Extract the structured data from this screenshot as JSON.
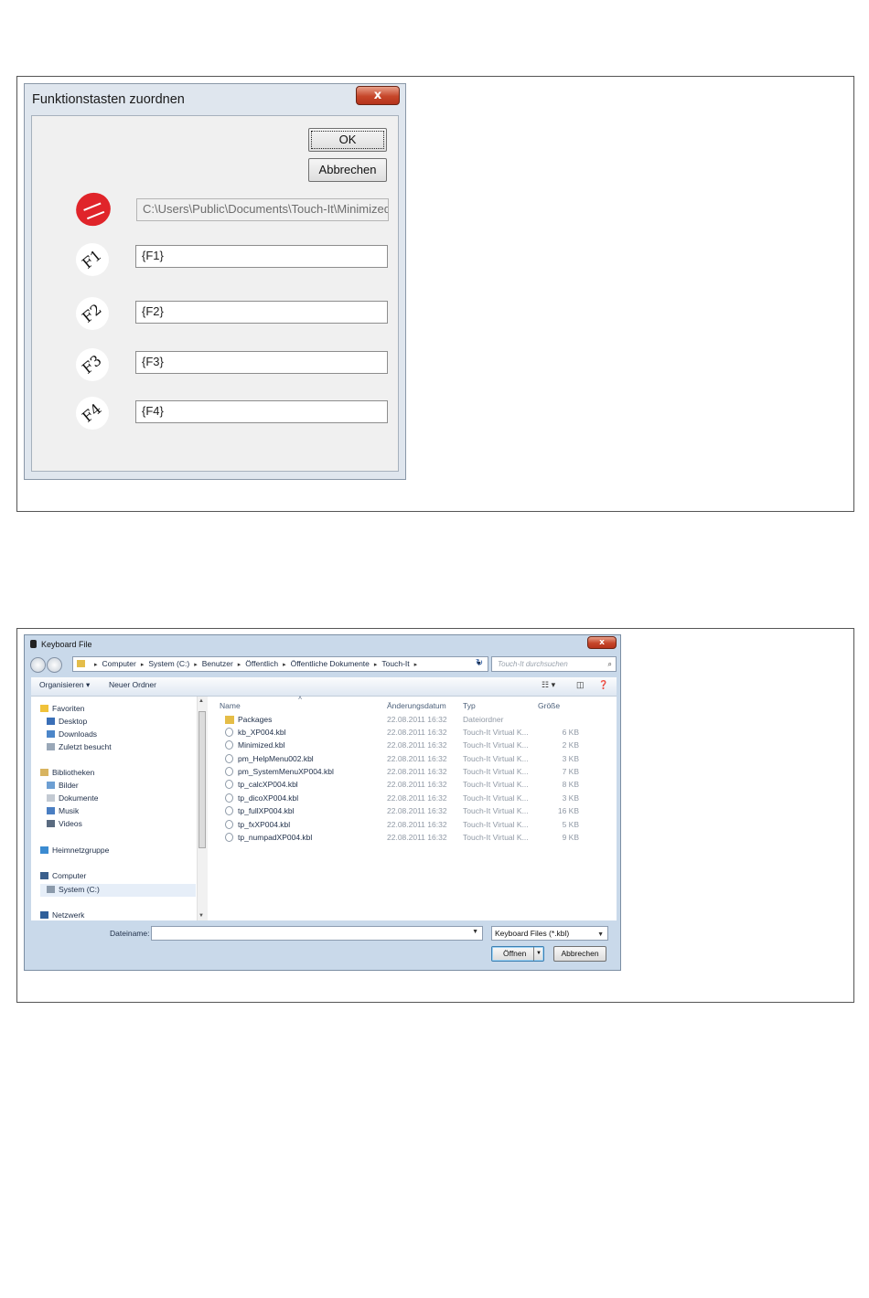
{
  "dialog1": {
    "title": "Funktionstasten zuordnen",
    "close_label": "x",
    "ok_label": "OK",
    "cancel_label": "Abbrechen",
    "path_value": "C:\\Users\\Public\\Documents\\Touch-It\\Minimized.",
    "app_icon": "touch-it-red-icon",
    "keys": [
      {
        "icon_label": "F1",
        "value": "{F1}"
      },
      {
        "icon_label": "F2",
        "value": "{F2}"
      },
      {
        "icon_label": "F3",
        "value": "{F3}"
      },
      {
        "icon_label": "F4",
        "value": "{F4}"
      }
    ]
  },
  "dialog2": {
    "title": "Keyboard File",
    "close_label": "x",
    "breadcrumb": [
      "Computer",
      "System (C:)",
      "Benutzer",
      "Öffentlich",
      "Öffentliche Dokumente",
      "Touch-It"
    ],
    "search_placeholder": "Touch-It durchsuchen",
    "toolbar": {
      "organize": "Organisieren ▾",
      "new_folder": "Neuer Ordner"
    },
    "nav": {
      "favorites": "Favoriten",
      "desktop": "Desktop",
      "downloads": "Downloads",
      "recent": "Zuletzt besucht",
      "libraries": "Bibliotheken",
      "pictures": "Bilder",
      "documents": "Dokumente",
      "music": "Musik",
      "videos": "Videos",
      "homegroup": "Heimnetzgruppe",
      "computer": "Computer",
      "system": "System (C:)",
      "network": "Netzwerk"
    },
    "columns": {
      "name": "Name",
      "date": "Änderungsdatum",
      "type": "Typ",
      "size": "Größe"
    },
    "files": [
      {
        "name": "Packages",
        "date": "22.08.2011 16:32",
        "type": "Dateiordner",
        "size": ""
      },
      {
        "name": "kb_XP004.kbl",
        "date": "22.08.2011 16:32",
        "type": "Touch-It Virtual K...",
        "size": "6 KB"
      },
      {
        "name": "Minimized.kbl",
        "date": "22.08.2011 16:32",
        "type": "Touch-It Virtual K...",
        "size": "2 KB"
      },
      {
        "name": "pm_HelpMenu002.kbl",
        "date": "22.08.2011 16:32",
        "type": "Touch-It Virtual K...",
        "size": "3 KB"
      },
      {
        "name": "pm_SystemMenuXP004.kbl",
        "date": "22.08.2011 16:32",
        "type": "Touch-It Virtual K...",
        "size": "7 KB"
      },
      {
        "name": "tp_calcXP004.kbl",
        "date": "22.08.2011 16:32",
        "type": "Touch-It Virtual K...",
        "size": "8 KB"
      },
      {
        "name": "tp_dicoXP004.kbl",
        "date": "22.08.2011 16:32",
        "type": "Touch-It Virtual K...",
        "size": "3 KB"
      },
      {
        "name": "tp_fullXP004.kbl",
        "date": "22.08.2011 16:32",
        "type": "Touch-It Virtual K...",
        "size": "16 KB"
      },
      {
        "name": "tp_fxXP004.kbl",
        "date": "22.08.2011 16:32",
        "type": "Touch-It Virtual K...",
        "size": "5 KB"
      },
      {
        "name": "tp_numpadXP004.kbl",
        "date": "22.08.2011 16:32",
        "type": "Touch-It Virtual K...",
        "size": "9 KB"
      }
    ],
    "filename_label": "Dateiname:",
    "filename_value": "",
    "filter_value": "Keyboard Files (*.kbl)",
    "open_label": "Öffnen",
    "cancel_label": "Abbrechen"
  }
}
